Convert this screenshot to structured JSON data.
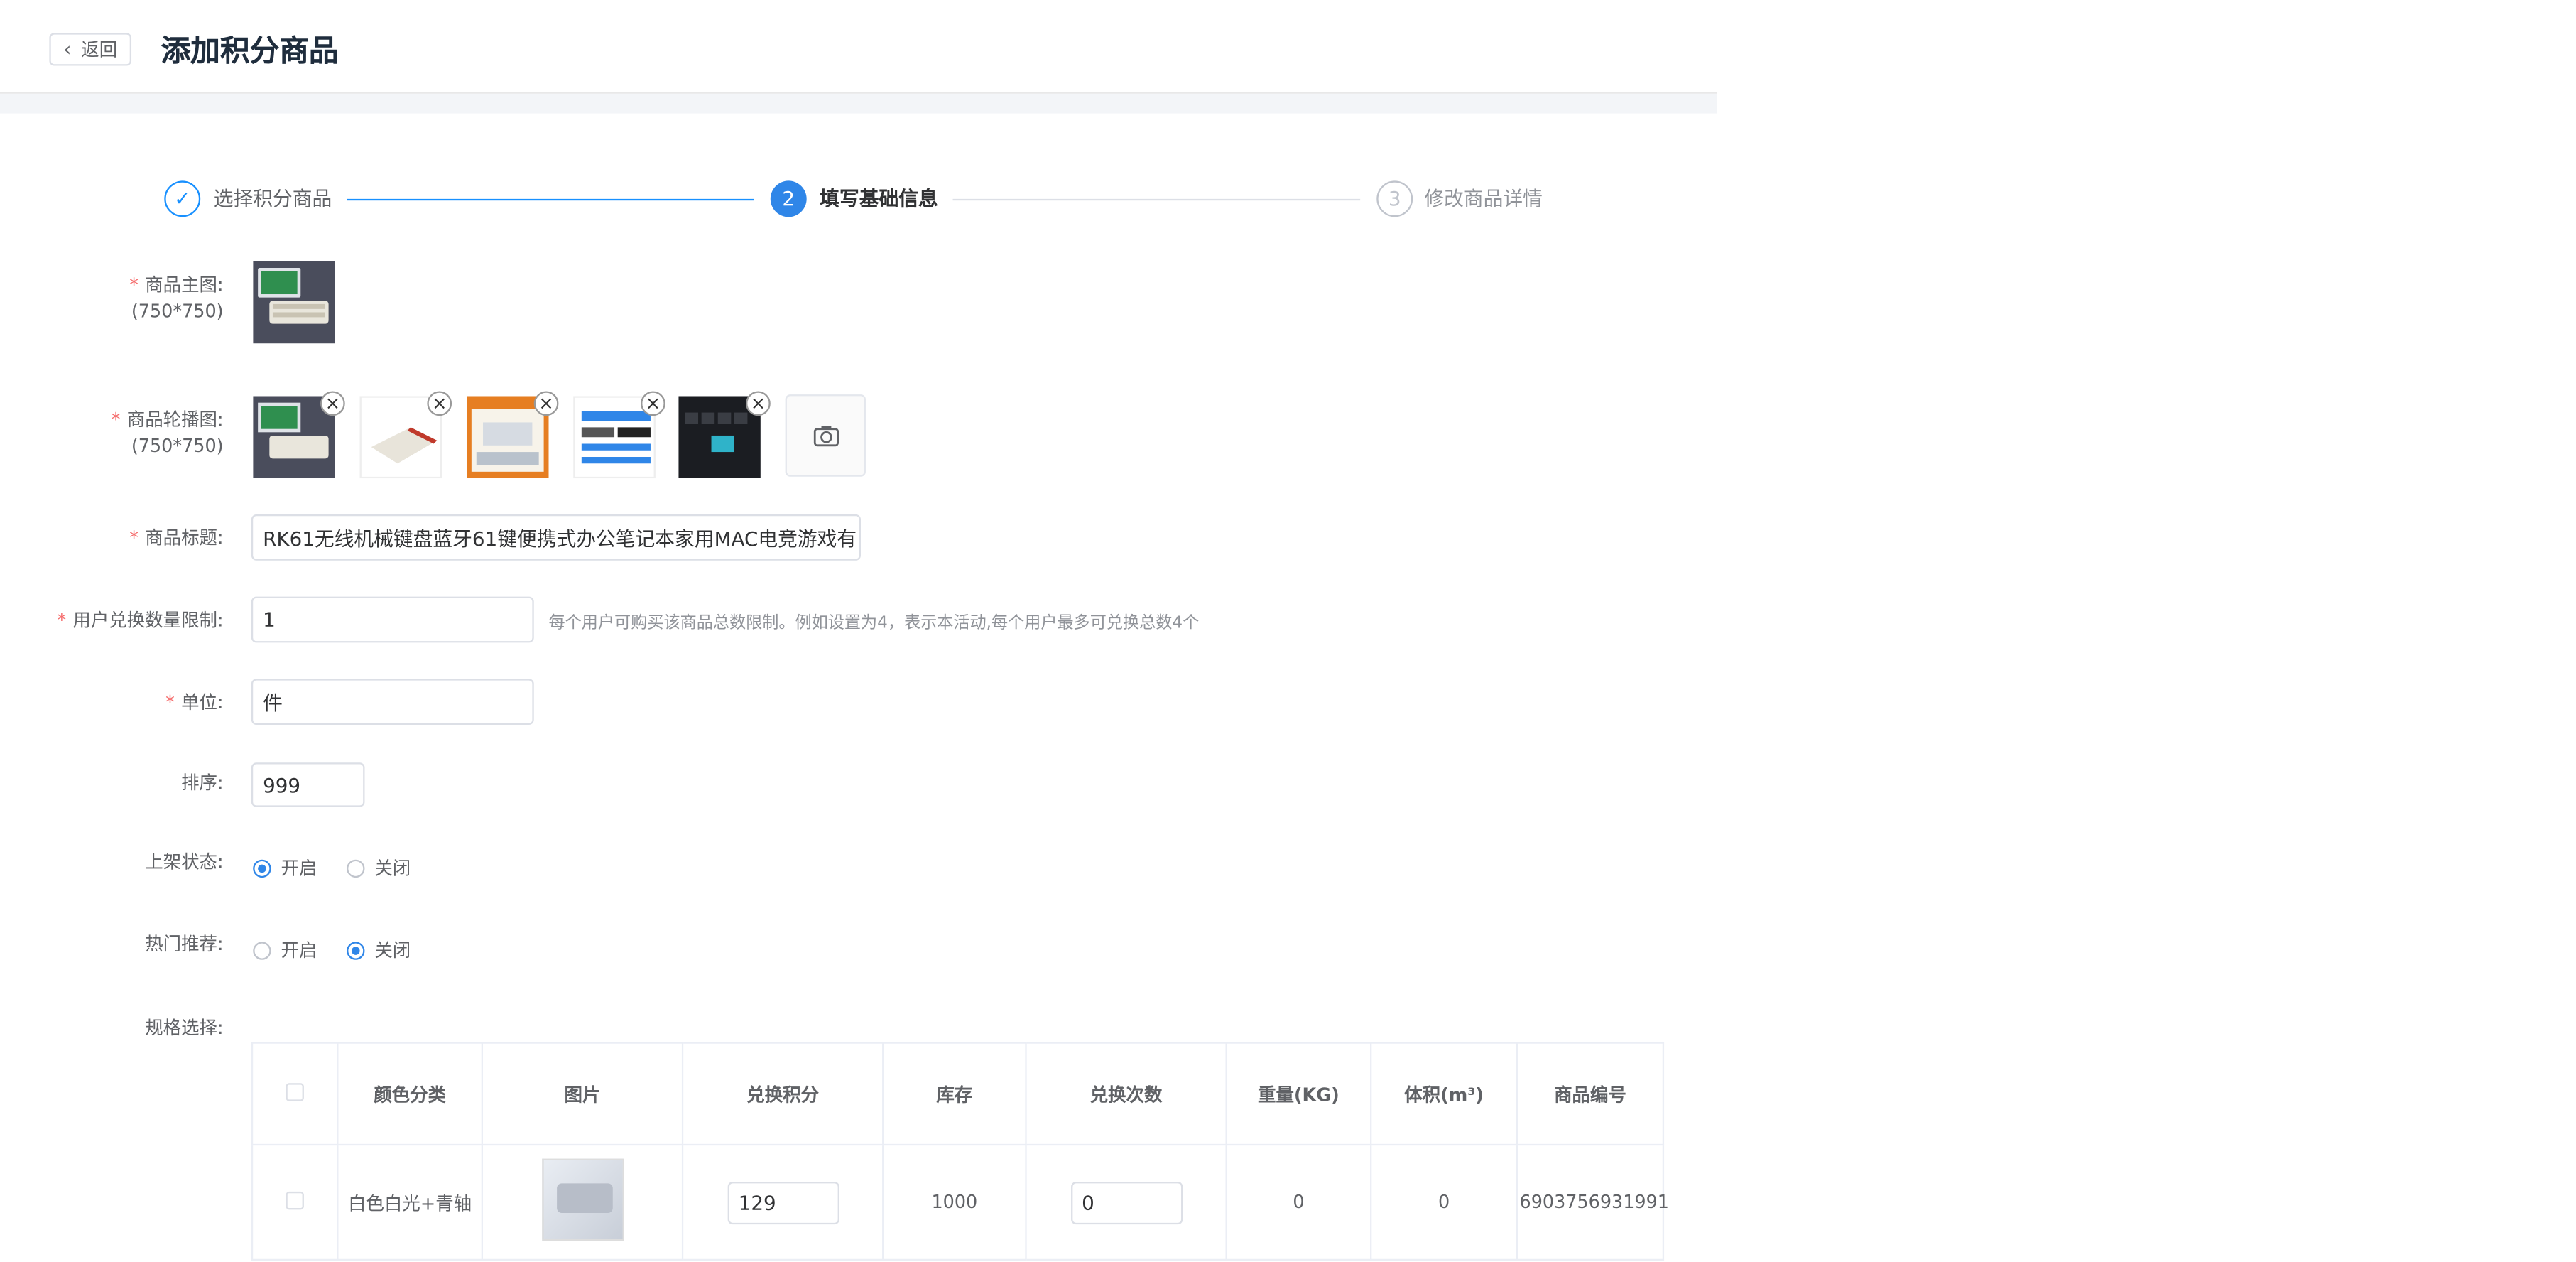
{
  "header": {
    "back_label": "返回",
    "title": "添加积分商品"
  },
  "steps": [
    {
      "index": "✓",
      "label": "选择积分商品"
    },
    {
      "index": "2",
      "label": "填写基础信息"
    },
    {
      "index": "3",
      "label": "修改商品详情"
    }
  ],
  "form": {
    "main_image_label": "商品主图:",
    "main_image_size": "(750*750)",
    "carousel_label": "商品轮播图:",
    "carousel_size": "(750*750)",
    "title_label": "商品标题:",
    "title_value": "RK61无线机械键盘蓝牙61键便携式办公笔记本家用MAC电竞游戏有",
    "limit_label": "用户兑换数量限制:",
    "limit_value": "1",
    "limit_tip": "每个用户可购买该商品总数限制。例如设置为4，表示本活动,每个用户最多可兑换总数4个",
    "unit_label": "单位:",
    "unit_value": "件",
    "sort_label": "排序:",
    "sort_value": "999",
    "status_label": "上架状态:",
    "hot_label": "热门推荐:",
    "radio_on": "开启",
    "radio_off": "关闭",
    "spec_label": "规格选择:"
  },
  "table": {
    "headers": [
      "颜色分类",
      "图片",
      "兑换积分",
      "库存",
      "兑换次数",
      "重量(KG)",
      "体积(m³)",
      "商品编号"
    ],
    "rows": [
      {
        "color": "白色白光+青轴",
        "points": "129",
        "stock": "1000",
        "times": "0",
        "weight": "0",
        "volume": "0",
        "sku": "6903756931991"
      }
    ]
  },
  "colors": {
    "primary": "#2f86e8",
    "required": "#f56c6c"
  }
}
